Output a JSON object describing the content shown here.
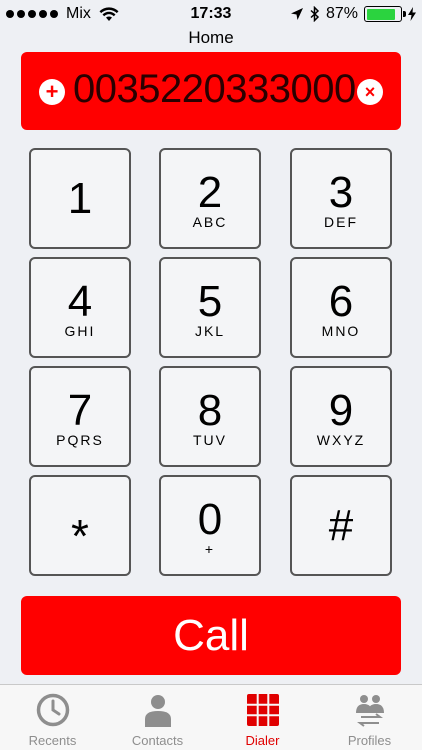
{
  "status_bar": {
    "carrier": "Mix",
    "time": "17:33",
    "battery": "87%",
    "battery_level": 0.87
  },
  "nav": {
    "title": "Home"
  },
  "dialer": {
    "number": "0035220333000",
    "add_symbol": "+",
    "clear_symbol": "×"
  },
  "keys": [
    {
      "digit": "1",
      "letters": ""
    },
    {
      "digit": "2",
      "letters": "ABC"
    },
    {
      "digit": "3",
      "letters": "DEF"
    },
    {
      "digit": "4",
      "letters": "GHI"
    },
    {
      "digit": "5",
      "letters": "JKL"
    },
    {
      "digit": "6",
      "letters": "MNO"
    },
    {
      "digit": "7",
      "letters": "PQRS"
    },
    {
      "digit": "8",
      "letters": "TUV"
    },
    {
      "digit": "9",
      "letters": "WXYZ"
    },
    {
      "digit": "*",
      "letters": ""
    },
    {
      "digit": "0",
      "letters": "+"
    },
    {
      "digit": "#",
      "letters": ""
    }
  ],
  "call": {
    "label": "Call"
  },
  "tabs": [
    {
      "label": "Recents",
      "icon": "clock-icon",
      "active": false
    },
    {
      "label": "Contacts",
      "icon": "person-icon",
      "active": false
    },
    {
      "label": "Dialer",
      "icon": "keypad-grid-icon",
      "active": true
    },
    {
      "label": "Profiles",
      "icon": "profiles-icon",
      "active": false
    }
  ],
  "colors": {
    "accent": "#ff0000",
    "tab_active": "#e00000",
    "tab_inactive": "#8e8e8e",
    "battery": "#2bd33f"
  }
}
